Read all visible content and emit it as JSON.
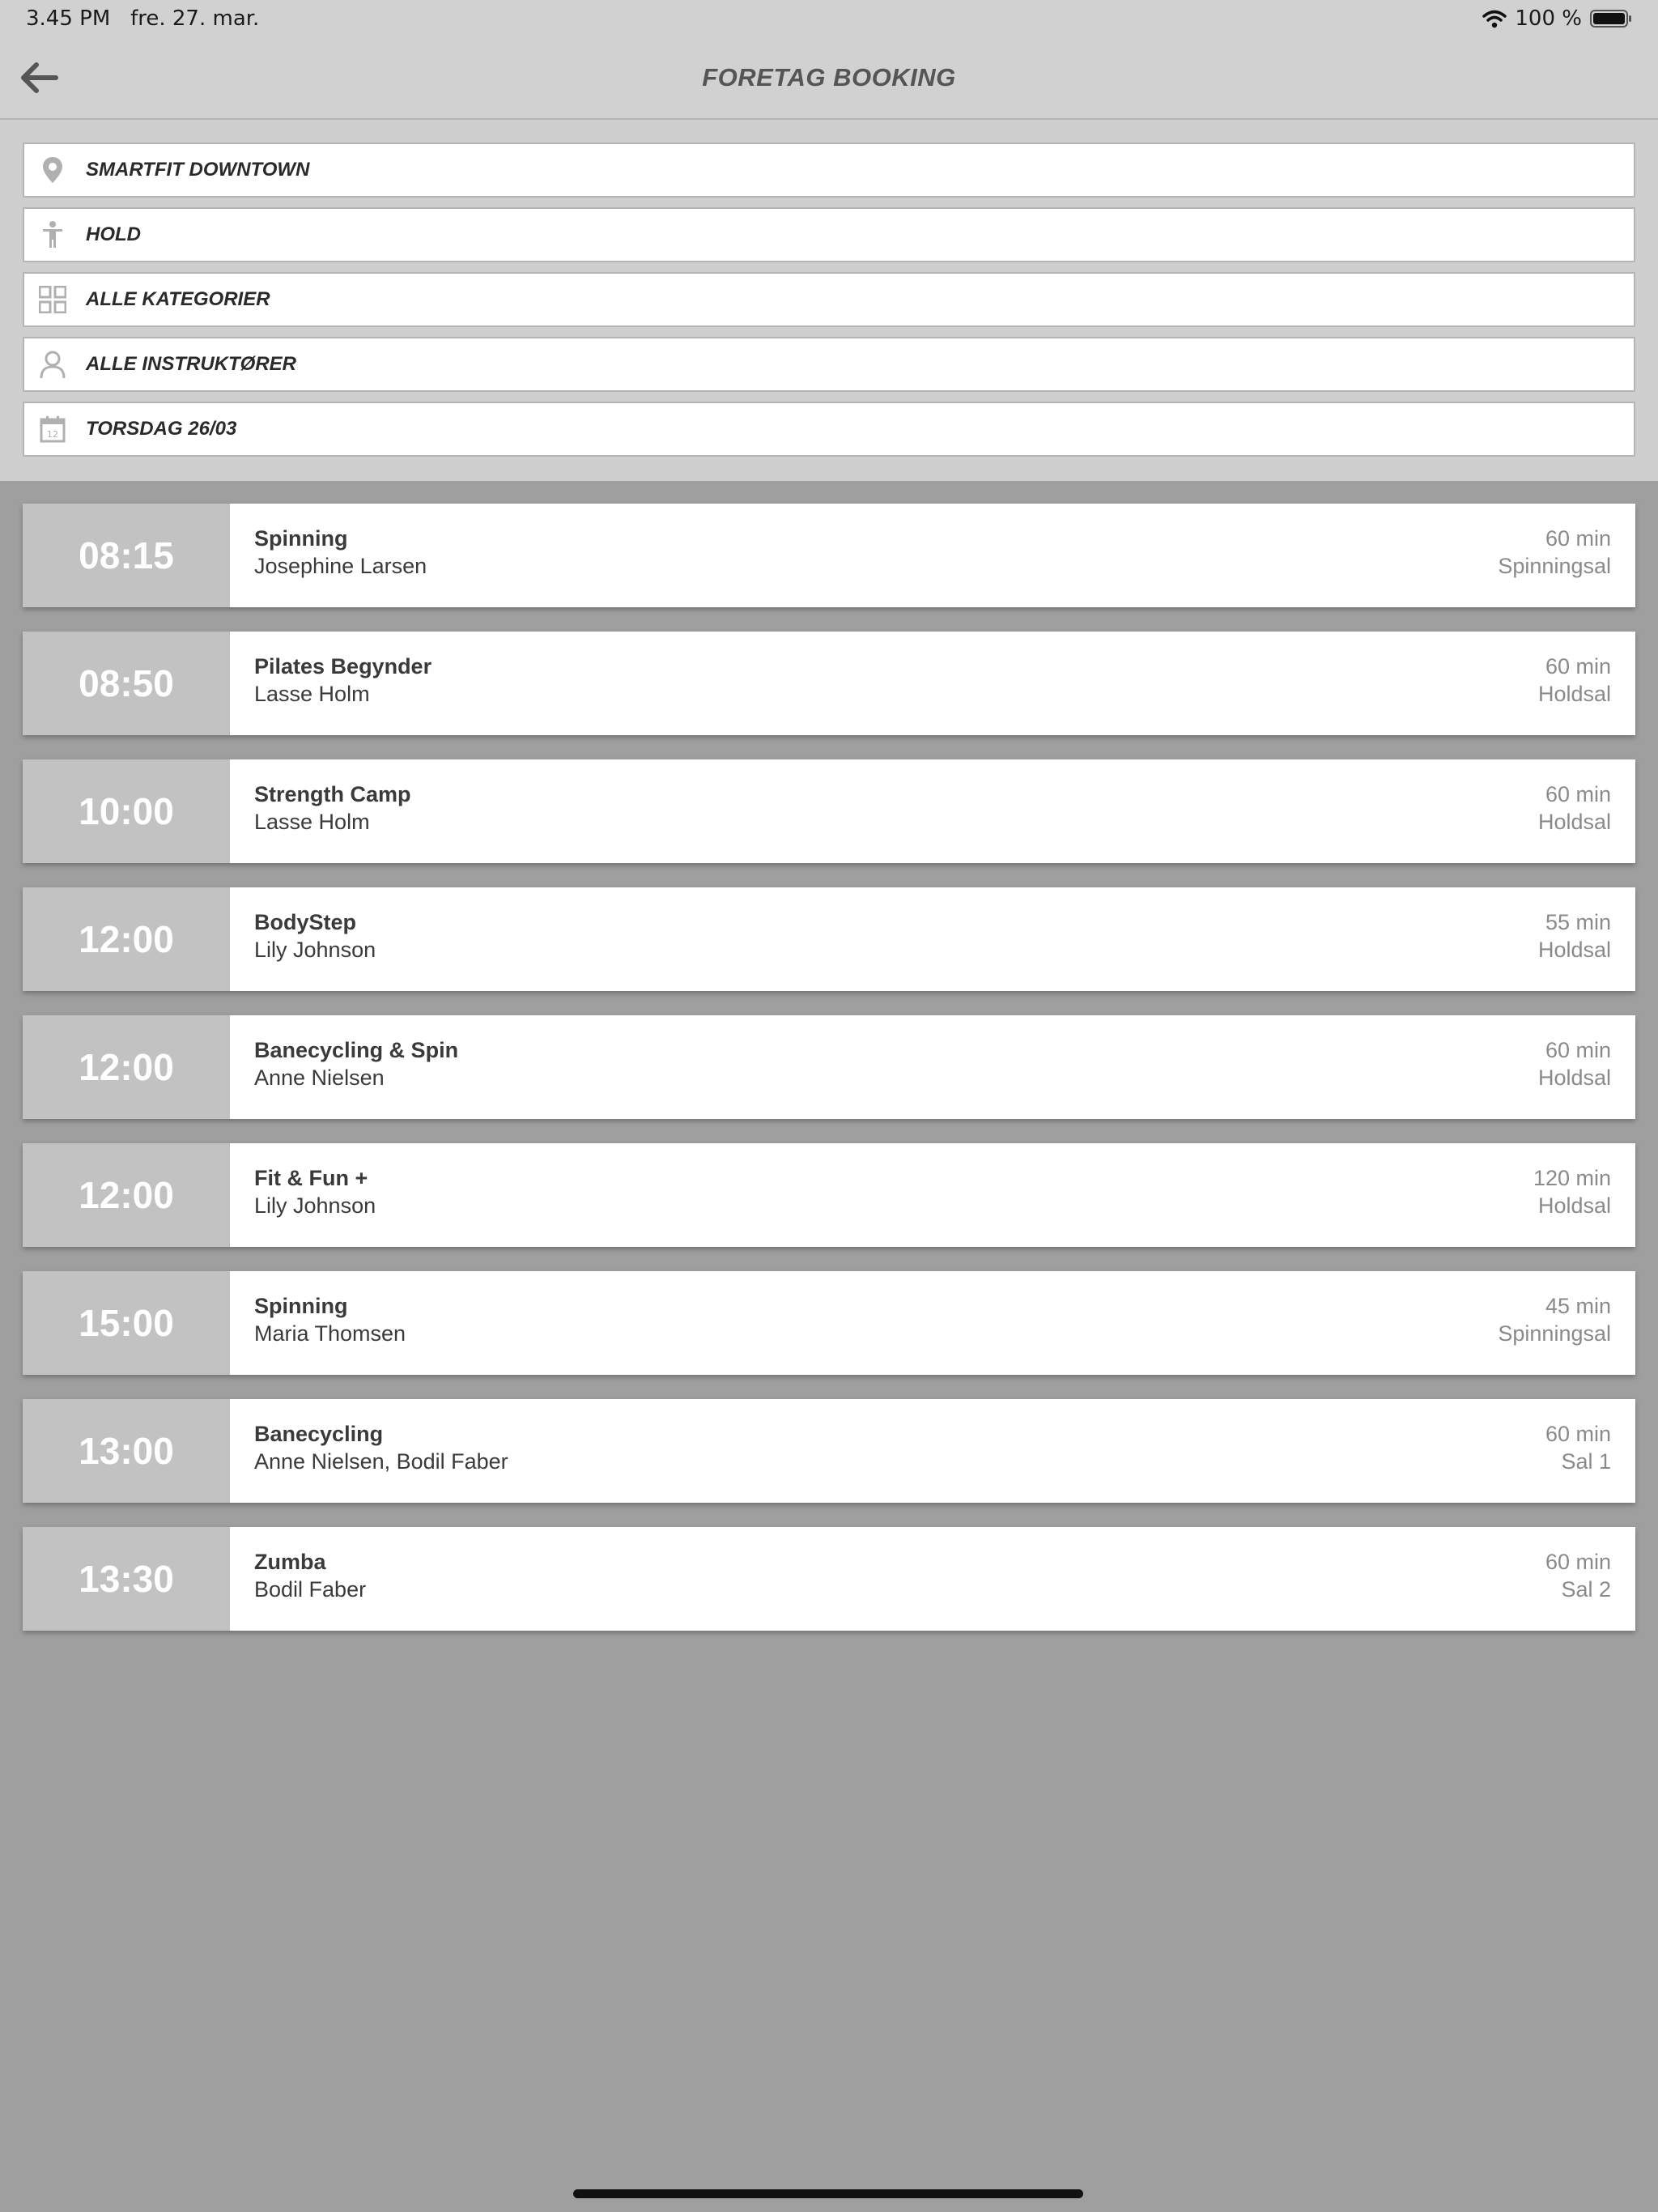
{
  "status_bar": {
    "time": "3.45 PM",
    "date": "fre. 27. mar.",
    "battery": "100 %"
  },
  "header": {
    "title": "FORETAG BOOKING"
  },
  "filters": [
    {
      "label": "SMARTFIT DOWNTOWN",
      "icon": "location-pin-icon"
    },
    {
      "label": "HOLD",
      "icon": "person-accessibility-icon"
    },
    {
      "label": "ALLE KATEGORIER",
      "icon": "grid-categories-icon"
    },
    {
      "label": "ALLE INSTRUKTØRER",
      "icon": "user-icon"
    },
    {
      "label": "TORSDAG 26/03",
      "icon": "calendar-icon",
      "calendar_day": "12"
    }
  ],
  "classes": [
    {
      "time": "08:15",
      "name": "Spinning",
      "instructor": "Josephine Larsen",
      "duration": "60 min",
      "room": "Spinningsal"
    },
    {
      "time": "08:50",
      "name": "Pilates Begynder",
      "instructor": "Lasse Holm",
      "duration": "60 min",
      "room": "Holdsal"
    },
    {
      "time": "10:00",
      "name": "Strength Camp",
      "instructor": "Lasse Holm",
      "duration": "60 min",
      "room": "Holdsal"
    },
    {
      "time": "12:00",
      "name": "BodyStep",
      "instructor": "Lily Johnson",
      "duration": "55 min",
      "room": "Holdsal"
    },
    {
      "time": "12:00",
      "name": "Banecycling & Spin",
      "instructor": "Anne Nielsen",
      "duration": "60 min",
      "room": "Holdsal"
    },
    {
      "time": "12:00",
      "name": "Fit & Fun +",
      "instructor": "Lily Johnson",
      "duration": "120 min",
      "room": "Holdsal"
    },
    {
      "time": "15:00",
      "name": "Spinning",
      "instructor": "Maria Thomsen",
      "duration": "45 min",
      "room": "Spinningsal"
    },
    {
      "time": "13:00",
      "name": "Banecycling",
      "instructor": "Anne Nielsen, Bodil Faber",
      "duration": "60 min",
      "room": "Sal 1"
    },
    {
      "time": "13:30",
      "name": "Zumba",
      "instructor": "Bodil Faber",
      "duration": "60 min",
      "room": "Sal 2"
    }
  ],
  "colors": {
    "header_bg": "#d1d1d1",
    "list_bg": "#9f9f9f",
    "time_block_bg": "#c2c2c2",
    "icon_color": "#b0b0b0"
  }
}
